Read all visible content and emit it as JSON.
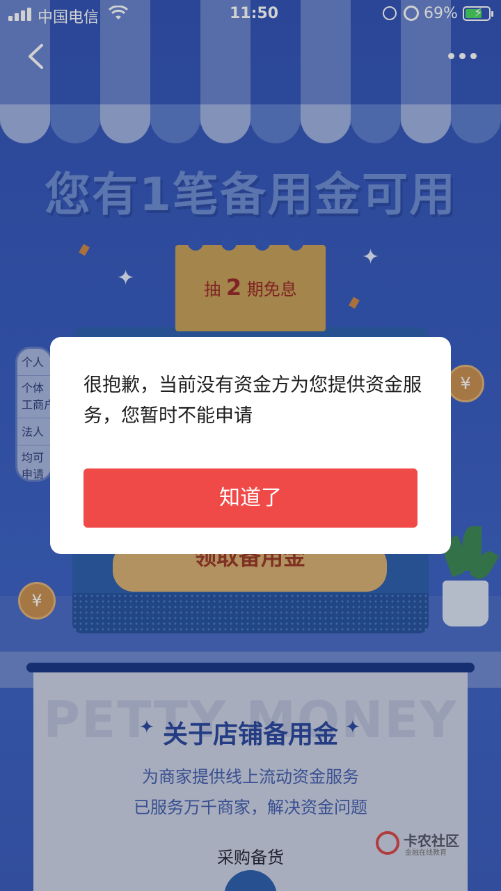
{
  "status_bar": {
    "carrier": "中国电信",
    "time": "11:50",
    "battery_percent": "69%",
    "battery_level": 0.69,
    "icons": [
      "signal-icon",
      "wifi-icon",
      "rotation-lock-icon",
      "alarm-icon",
      "battery-charging-icon"
    ]
  },
  "nav": {
    "back_icon": "chevron-left-icon",
    "more_icon": "more-dots-icon"
  },
  "hero": {
    "title": "您有1笔备用金可用",
    "ticket_prefix": "抽",
    "ticket_number": "2",
    "ticket_suffix": "期免息"
  },
  "side_card": {
    "rows": [
      "个人",
      "个体",
      "工商户",
      "法人",
      "均可",
      "申请"
    ]
  },
  "machine": {
    "button_label": "领取备用金",
    "coin_symbol": "¥"
  },
  "info": {
    "watermark": "PETTY MONEY",
    "title": "关于店铺备用金",
    "line1": "为商家提供线上流动资金服务",
    "line2": "已服务万千商家，解决资金问题",
    "feature": "采购备货"
  },
  "brand": {
    "name": "卡农社区",
    "tagline": "金融在线教育"
  },
  "dialog": {
    "message": "很抱歉，当前没有资金方为您提供资金服务，您暂时不能申请",
    "confirm_label": "知道了"
  },
  "colors": {
    "background": "#3a5ec2",
    "confirm_button": "#f04a48",
    "ticket": "#c9a35c",
    "title_text": "#2c4aa0"
  }
}
